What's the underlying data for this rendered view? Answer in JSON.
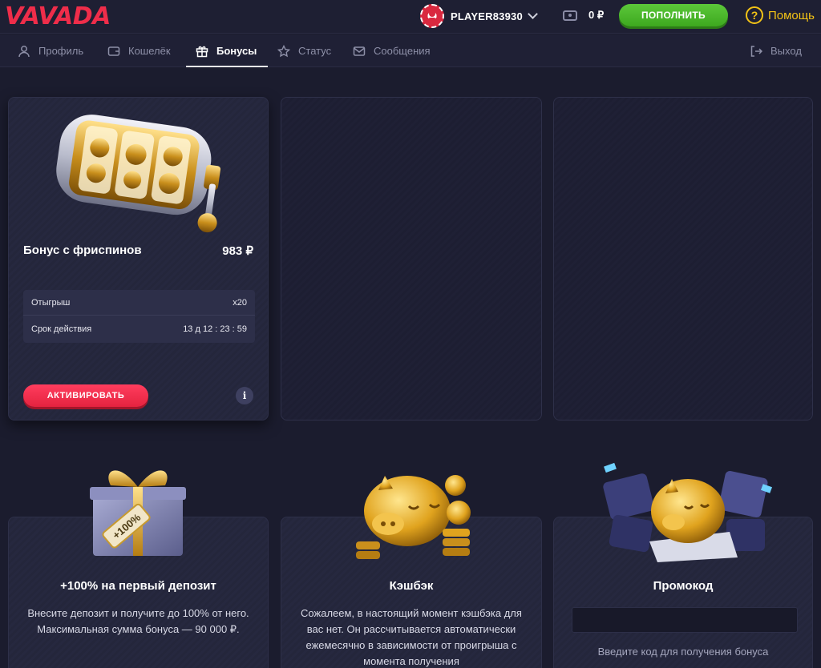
{
  "header": {
    "logo": "VAVADA",
    "username": "PLAYER83930",
    "balance": "0 ₽",
    "deposit_label": "ПОПОЛНИТЬ",
    "help_label": "Помощь"
  },
  "tabs": [
    {
      "label": "Профиль",
      "icon": "user-icon"
    },
    {
      "label": "Кошелёк",
      "icon": "wallet-icon"
    },
    {
      "label": "Бонусы",
      "icon": "gift-icon",
      "active": true
    },
    {
      "label": "Статус",
      "icon": "star-icon"
    },
    {
      "label": "Сообщения",
      "icon": "envelope-icon"
    },
    {
      "label": "Выход",
      "icon": "logout-icon"
    }
  ],
  "bonus_card": {
    "title": "Бонус с фриспинов",
    "amount": "983 ₽",
    "rows": [
      {
        "label": "Отыгрыш",
        "value": "x20"
      },
      {
        "label": "Срок действия",
        "value": "13 д 12 : 23 : 59"
      }
    ],
    "activate_label": "АКТИВИРОВАТЬ",
    "info_label": "i"
  },
  "promos": [
    {
      "title": "+100% на первый депозит",
      "text": "Внесите депозит и получите до 100% от него. Максимальная сумма бонуса — 90 000 ₽.",
      "gift_tag": "+100%"
    },
    {
      "title": "Кэшбэк",
      "text": "Сожалеем, в настоящий момент кэшбэка для вас нет. Он рассчитывается автоматически ежемесячно в зависимости от проигрыша с момента получения"
    },
    {
      "title": "Промокод",
      "input_value": "",
      "hint": "Введите код для получения бонуса"
    }
  ],
  "colors": {
    "brand_red": "#ef2d4a",
    "deposit_green": "#4cbb2c",
    "help_yellow": "#f3c316",
    "background": "#1b1c2e"
  }
}
